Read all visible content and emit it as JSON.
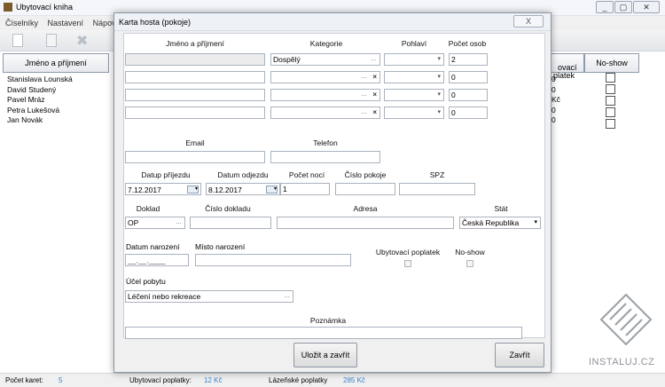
{
  "window": {
    "title": "Ubytovací kniha"
  },
  "menu": [
    "Číselníky",
    "Nastavení",
    "Nápově"
  ],
  "grid": {
    "headers": {
      "name": "Jméno a příjmení",
      "fee": "ovací\nplatek",
      "noshow": "No-show"
    },
    "rows": [
      {
        "name": "Stanislava Lounská",
        "fee": "0"
      },
      {
        "name": "David Studený",
        "fee": "0"
      },
      {
        "name": "Pavel Mráz",
        "fee": "Kč"
      },
      {
        "name": "Petra Lukešová",
        "fee": "0"
      },
      {
        "name": "Jan Novák",
        "fee": "0"
      }
    ]
  },
  "statusbar": {
    "count_label": "Počet karet:",
    "count_value": "5",
    "fee_label": "Ubytovací poplatky:",
    "fee_value": "12 Kč",
    "spa_label": "Lázeňské poplatky",
    "spa_value": "285 Kč"
  },
  "dialog": {
    "title": "Karta hosta (pokoje)",
    "close_symbol": "X",
    "headers": {
      "name": "Jméno a příjmení",
      "category": "Kategorie",
      "gender": "Pohlaví",
      "persons": "Počet osob"
    },
    "guest_rows": [
      {
        "category": "Dospělý",
        "persons": "2"
      },
      {
        "category": "",
        "persons": "0"
      },
      {
        "category": "",
        "persons": "0"
      },
      {
        "category": "",
        "persons": "0"
      }
    ],
    "email_label": "Email",
    "phone_label": "Telefon",
    "arrival_label": "Datup příjezdu",
    "arrival_value": "7.12.2017",
    "departure_label": "Datum odjezdu",
    "departure_value": "8.12.2017",
    "nights_label": "Počet nocí",
    "nights_value": "1",
    "room_label": "Číslo pokoje",
    "spz_label": "SPZ",
    "doc_label": "Doklad",
    "doc_value": "OP",
    "doc_number_label": "Číslo dokladu",
    "address_label": "Adresa",
    "country_label": "Stát",
    "country_value": "Česká Republika",
    "birthdate_label": "Datum narození",
    "birthdate_value": "__.__.____",
    "birthplace_label": "Místo narození",
    "fee_label": "Ubytovací poplatek",
    "noshow_label": "No-show",
    "purpose_label": "Účel pobytu",
    "purpose_value": "Léčení nebo rekreace",
    "note_label": "Poznámka",
    "save_button": "Uložit a zavřít",
    "close_button": "Zavřít"
  },
  "watermark": "INSTALUJ.CZ"
}
